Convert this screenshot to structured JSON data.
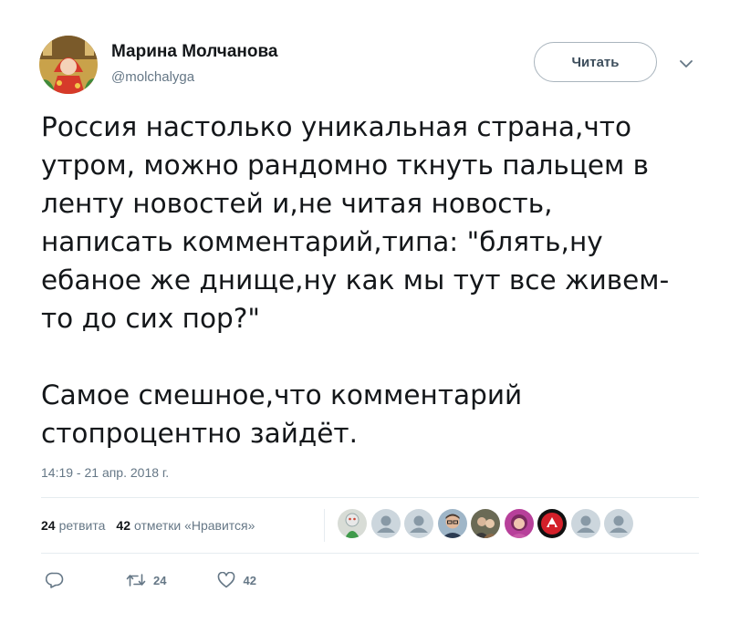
{
  "author": {
    "name": "Марина Молчанова",
    "handle": "@molchalyga",
    "avatar_icon": "avatar-icon"
  },
  "follow_button": {
    "label": "Читать"
  },
  "menu": {
    "icon": "chevron-down-icon"
  },
  "tweet": {
    "paragraph1_lines": [
      "Россия настолько уникальная страна,что",
      "утром, можно рандомно ткнуть пальцем в",
      "ленту новостей и,не читая новость,",
      "написать комментарий,типа: \"блять,ну",
      "ебаное же днище,ну как мы тут все живем-",
      "то  до сих пор?\""
    ],
    "paragraph2_lines": [
      "Самое смешное,что комментарий",
      "стопроцентно зайдёт."
    ],
    "timestamp": "14:19 - 21 апр. 2018 г."
  },
  "stats": {
    "retweets_count": "24",
    "retweets_label": "ретвита",
    "likes_count": "42",
    "likes_label": "отметки «Нравится»"
  },
  "actions": {
    "reply_icon": "reply-icon",
    "retweet_icon": "retweet-icon",
    "retweet_count": "24",
    "like_icon": "heart-icon",
    "like_count": "42"
  },
  "colors": {
    "text": "#14171a",
    "secondary": "#657786",
    "divider": "#e6ecf0",
    "default_avatar": "#ccd6dd"
  }
}
